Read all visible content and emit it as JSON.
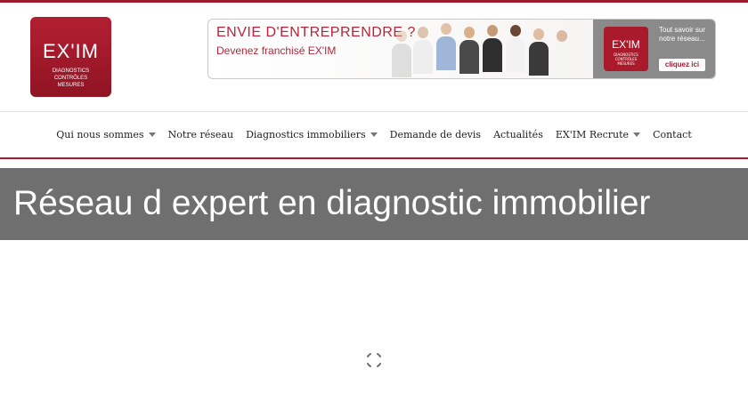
{
  "header": {
    "logo": {
      "word": "EX'IM",
      "tagline": [
        "DIAGNOSTICS",
        "CONTRÔLES",
        "MESURES"
      ]
    },
    "banner": {
      "title": "ENVIE D'ENTREPRENDRE ?",
      "subtitle": "Devenez franchisé EX'IM",
      "side_text": "Tout savoir sur notre réseau...",
      "cta_label": "cliquez ici"
    }
  },
  "nav": {
    "items": [
      {
        "label": "Qui nous sommes",
        "dropdown": true
      },
      {
        "label": "Notre réseau",
        "dropdown": false
      },
      {
        "label": "Diagnostics immobiliers",
        "dropdown": true
      },
      {
        "label": "Demande de devis",
        "dropdown": false
      },
      {
        "label": "Actualités",
        "dropdown": false
      },
      {
        "label": "EX'IM Recrute",
        "dropdown": true
      },
      {
        "label": "Contact",
        "dropdown": false
      }
    ]
  },
  "hero": {
    "title": "Réseau d expert en diagnostic immobilier"
  },
  "colors": {
    "brand": "#a81a2c",
    "hero_bg": "#6f6f6f",
    "nav_rule": "#a51d2d"
  },
  "icons": {
    "loading": "spinner-icon",
    "dropdown": "caret-down-icon"
  }
}
